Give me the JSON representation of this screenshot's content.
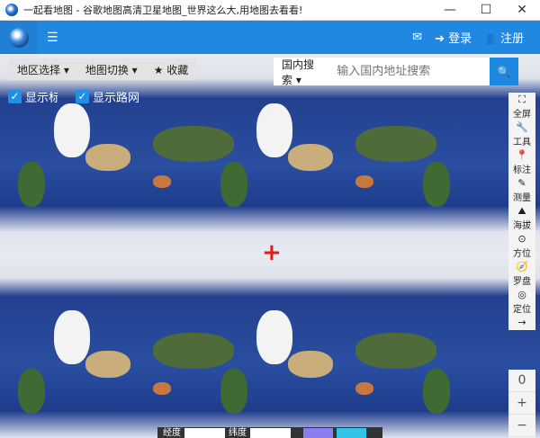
{
  "window": {
    "title": "一起看地图 - 谷歌地图高清卫星地图_世界这么大,用地图去看看!",
    "min": "—",
    "max": "☐",
    "close": "✕"
  },
  "header": {
    "menu_icon": "☰",
    "mail_icon": "✉",
    "login_icon": "➔",
    "login": "登录",
    "user_icon": "👤",
    "register": "注册"
  },
  "toolbar": {
    "region": "地区选择 ▾",
    "map_switch": "地图切换 ▾",
    "favorite": "★ 收藏"
  },
  "checkboxes": [
    {
      "label": "显示标注",
      "checked": true
    },
    {
      "label": "显示路网",
      "checked": true
    }
  ],
  "search": {
    "scope": "国内搜索 ▾",
    "placeholder": "输入国内地址搜索",
    "icon": "🔍"
  },
  "side_tools": [
    {
      "icon": "⛶",
      "label": "全屏"
    },
    {
      "icon": "🔧",
      "label": "工具"
    },
    {
      "icon": "📍",
      "label": "标注"
    },
    {
      "icon": "✎",
      "label": "测量"
    },
    {
      "icon": "⛰",
      "label": "海拔"
    },
    {
      "icon": "⊙",
      "label": "方位"
    },
    {
      "icon": "🧭",
      "label": "罗盘"
    },
    {
      "icon": "◎",
      "label": "定位"
    }
  ],
  "side_arrow": "→",
  "zoom": {
    "level": "0",
    "in": "+",
    "out": "−"
  },
  "bottom": {
    "lng_label": "经度",
    "lat_label": "纬度"
  },
  "crosshair": "+"
}
